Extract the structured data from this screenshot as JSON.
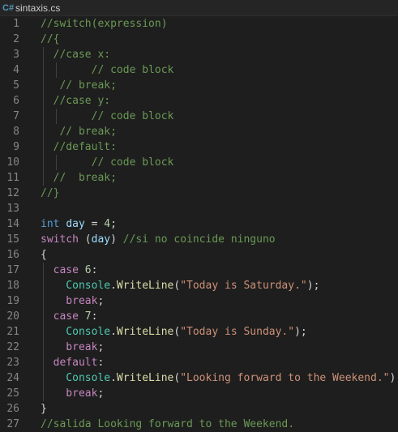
{
  "tab": {
    "icon": "csharp-icon",
    "title": "sintaxis.cs"
  },
  "colors": {
    "comment": "#6a9955",
    "keyword": "#569cd6",
    "control": "#c586c0",
    "variable": "#9cdcfe",
    "number": "#b5cea8",
    "string": "#ce9178",
    "class": "#4ec9b0",
    "function": "#dcdcaa",
    "plain": "#d4d4d4",
    "line_number": "#858585",
    "background": "#1e1e1e"
  },
  "lines": [
    {
      "n": "1",
      "g": 0,
      "tokens": [
        [
          "comment",
          "//switch(expression)"
        ]
      ]
    },
    {
      "n": "2",
      "g": 0,
      "tokens": [
        [
          "comment",
          "//{"
        ]
      ]
    },
    {
      "n": "3",
      "g": 1,
      "tokens": [
        [
          "comment",
          "  //case x:"
        ]
      ]
    },
    {
      "n": "4",
      "g": 2,
      "tokens": [
        [
          "comment",
          "        // code block"
        ]
      ]
    },
    {
      "n": "5",
      "g": 1,
      "tokens": [
        [
          "comment",
          "   // break;"
        ]
      ]
    },
    {
      "n": "6",
      "g": 1,
      "tokens": [
        [
          "comment",
          "  //case y:"
        ]
      ]
    },
    {
      "n": "7",
      "g": 2,
      "tokens": [
        [
          "comment",
          "        // code block"
        ]
      ]
    },
    {
      "n": "8",
      "g": 1,
      "tokens": [
        [
          "comment",
          "   // break;"
        ]
      ]
    },
    {
      "n": "9",
      "g": 1,
      "tokens": [
        [
          "comment",
          "  //default:"
        ]
      ]
    },
    {
      "n": "10",
      "g": 2,
      "tokens": [
        [
          "comment",
          "        // code block"
        ]
      ]
    },
    {
      "n": "11",
      "g": 1,
      "tokens": [
        [
          "comment",
          "  //  break;"
        ]
      ]
    },
    {
      "n": "12",
      "g": 0,
      "tokens": [
        [
          "comment",
          "//}"
        ]
      ]
    },
    {
      "n": "13",
      "g": 0,
      "tokens": []
    },
    {
      "n": "14",
      "g": 0,
      "tokens": [
        [
          "kw",
          "int"
        ],
        [
          "plain",
          " "
        ],
        [
          "var",
          "day"
        ],
        [
          "plain",
          " = "
        ],
        [
          "num",
          "4"
        ],
        [
          "plain",
          ";"
        ]
      ]
    },
    {
      "n": "15",
      "g": 0,
      "tokens": [
        [
          "ctrl",
          "switch"
        ],
        [
          "plain",
          " ("
        ],
        [
          "var",
          "day"
        ],
        [
          "plain",
          ") "
        ],
        [
          "comment",
          "//si no coincide ninguno"
        ]
      ]
    },
    {
      "n": "16",
      "g": 0,
      "tokens": [
        [
          "plain",
          "{"
        ]
      ]
    },
    {
      "n": "17",
      "g": 1,
      "tokens": [
        [
          "ctrl",
          "  case"
        ],
        [
          "plain",
          " "
        ],
        [
          "num",
          "6"
        ],
        [
          "plain",
          ":"
        ]
      ]
    },
    {
      "n": "18",
      "g": 1,
      "tokens": [
        [
          "cls",
          "    Console"
        ],
        [
          "plain",
          "."
        ],
        [
          "fn",
          "WriteLine"
        ],
        [
          "plain",
          "("
        ],
        [
          "str",
          "\"Today is Saturday.\""
        ],
        [
          "plain",
          ");"
        ]
      ]
    },
    {
      "n": "19",
      "g": 1,
      "tokens": [
        [
          "ctrl",
          "    break"
        ],
        [
          "plain",
          ";"
        ]
      ]
    },
    {
      "n": "20",
      "g": 1,
      "tokens": [
        [
          "ctrl",
          "  case"
        ],
        [
          "plain",
          " "
        ],
        [
          "num",
          "7"
        ],
        [
          "plain",
          ":"
        ]
      ]
    },
    {
      "n": "21",
      "g": 1,
      "tokens": [
        [
          "cls",
          "    Console"
        ],
        [
          "plain",
          "."
        ],
        [
          "fn",
          "WriteLine"
        ],
        [
          "plain",
          "("
        ],
        [
          "str",
          "\"Today is Sunday.\""
        ],
        [
          "plain",
          ");"
        ]
      ]
    },
    {
      "n": "22",
      "g": 1,
      "tokens": [
        [
          "ctrl",
          "    break"
        ],
        [
          "plain",
          ";"
        ]
      ]
    },
    {
      "n": "23",
      "g": 1,
      "tokens": [
        [
          "ctrl",
          "  default"
        ],
        [
          "plain",
          ":"
        ]
      ]
    },
    {
      "n": "24",
      "g": 1,
      "tokens": [
        [
          "cls",
          "    Console"
        ],
        [
          "plain",
          "."
        ],
        [
          "fn",
          "WriteLine"
        ],
        [
          "plain",
          "("
        ],
        [
          "str",
          "\"Looking forward to the Weekend.\""
        ],
        [
          "plain",
          ");"
        ]
      ]
    },
    {
      "n": "25",
      "g": 1,
      "tokens": [
        [
          "ctrl",
          "    break"
        ],
        [
          "plain",
          ";"
        ]
      ]
    },
    {
      "n": "26",
      "g": 0,
      "tokens": [
        [
          "plain",
          "}"
        ]
      ]
    },
    {
      "n": "27",
      "g": 0,
      "tokens": [
        [
          "comment",
          "//salida Looking forward to the Weekend."
        ]
      ]
    }
  ]
}
